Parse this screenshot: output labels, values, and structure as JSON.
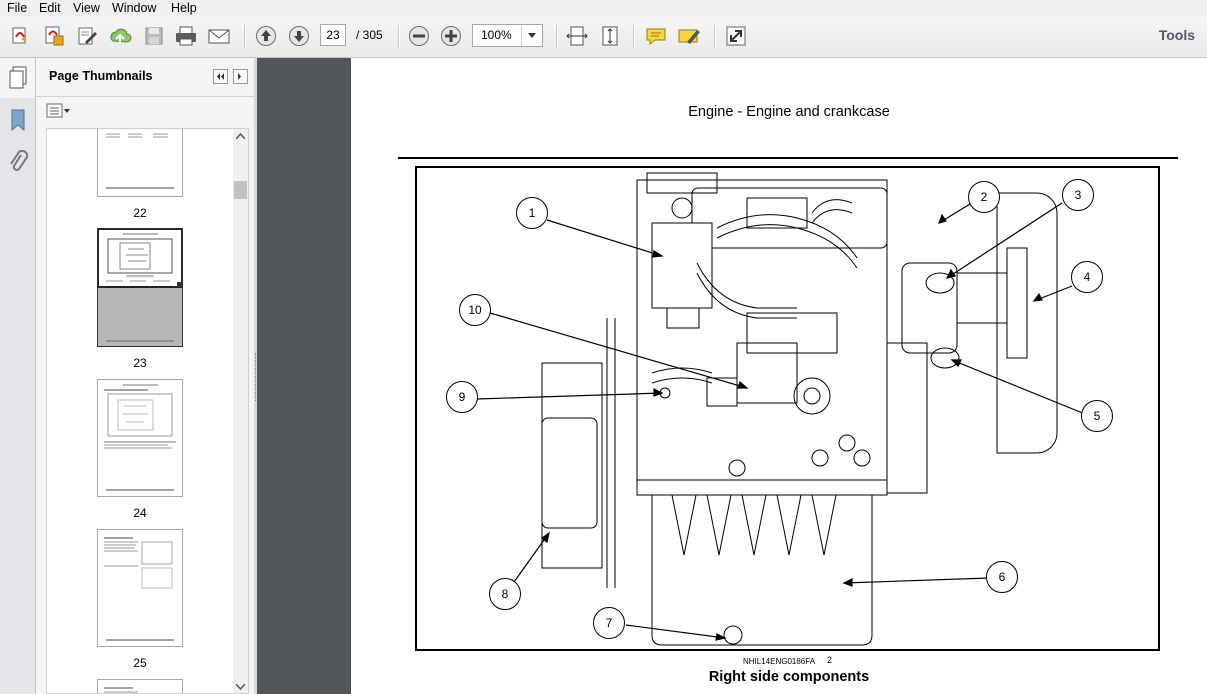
{
  "menu": {
    "items": [
      "File",
      "Edit",
      "View",
      "Window",
      "Help"
    ]
  },
  "toolbar": {
    "page_current": "23",
    "page_total": "/ 305",
    "zoom": "100%",
    "tools_label": "Tools",
    "icons": [
      "create-pdf-icon",
      "convert-icon",
      "edit-icon",
      "upload-icon",
      "save-icon",
      "print-icon",
      "email-icon",
      "prev-page-icon",
      "next-page-icon",
      "zoom-out-icon",
      "zoom-in-icon",
      "fit-width-icon",
      "fit-page-icon",
      "comment-icon",
      "highlight-icon",
      "fullscreen-icon"
    ]
  },
  "sidebar": {
    "title": "Page Thumbnails",
    "thumbnails": [
      {
        "label": "22"
      },
      {
        "label": "23"
      },
      {
        "label": "24"
      },
      {
        "label": "25"
      }
    ]
  },
  "document": {
    "header": "Engine - Engine and crankcase",
    "figure_code": "NHIL14ENG0186FA",
    "figure_index": "2",
    "caption": "Right side components",
    "callouts": [
      "1",
      "2",
      "3",
      "4",
      "5",
      "6",
      "7",
      "8",
      "9",
      "10"
    ]
  }
}
